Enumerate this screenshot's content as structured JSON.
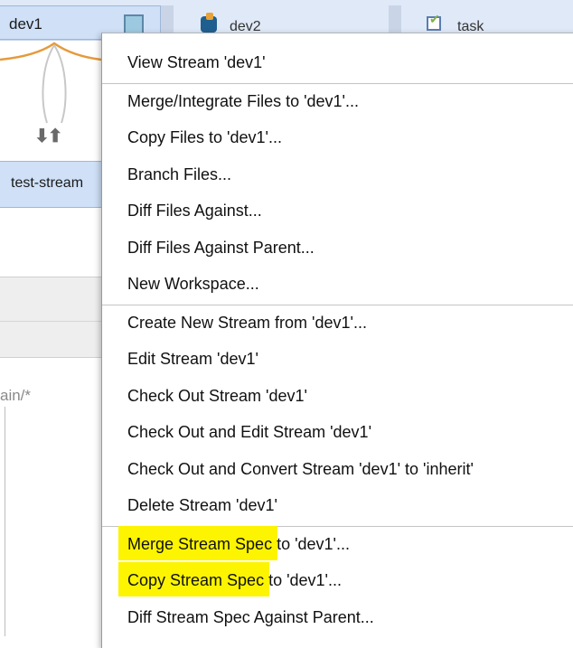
{
  "graph": {
    "node_dev1_label": "dev1",
    "node_dev2_label": "dev2",
    "node_task_label": "task",
    "node_test_label": "test-stream",
    "flow_arrows": "⬇⬆",
    "path_text": "ain/*"
  },
  "context_menu": {
    "groups": [
      {
        "items": [
          {
            "label": "View Stream 'dev1'"
          }
        ]
      },
      {
        "items": [
          {
            "label": "Merge/Integrate Files to 'dev1'..."
          },
          {
            "label": "Copy Files to 'dev1'..."
          },
          {
            "label": "Branch Files..."
          },
          {
            "label": "Diff Files Against..."
          },
          {
            "label": "Diff Files Against Parent..."
          },
          {
            "label": "New Workspace..."
          }
        ]
      },
      {
        "items": [
          {
            "label": "Create New Stream from 'dev1'..."
          },
          {
            "label": "Edit Stream 'dev1'"
          },
          {
            "label": "Check Out Stream 'dev1'"
          },
          {
            "label": "Check Out and Edit Stream 'dev1'"
          },
          {
            "label": "Check Out and Convert Stream 'dev1' to 'inherit'"
          },
          {
            "label": "Delete Stream 'dev1'"
          }
        ]
      },
      {
        "items": [
          {
            "label": "Merge Stream Spec to 'dev1'...",
            "highlight": "Merge Stream Spec"
          },
          {
            "label": "Copy Stream Spec to 'dev1'...",
            "highlight": "Copy Stream Spec"
          },
          {
            "label": "Diff Stream Spec Against Parent..."
          }
        ]
      }
    ]
  },
  "colors": {
    "highlight": "#fcf400",
    "node_fill": "#cfe0f7",
    "stream_line": "#e59a3c"
  }
}
